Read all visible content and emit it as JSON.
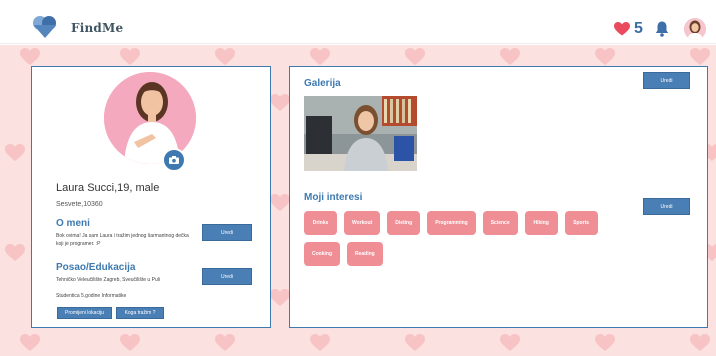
{
  "header": {
    "brand": "FindMe",
    "likes_count": "5",
    "icons": [
      "logo-heart-icon",
      "heart-icon",
      "bell-icon",
      "avatar"
    ]
  },
  "profile": {
    "name_line": "Laura Succi,19, male",
    "location": "Sesvete,10360",
    "about_title": "O meni",
    "about_text": "Bok ovima! Ja sam Laura i tražim jednog šarmantnog dečka koji je programer. :P",
    "about_edit": "Uredi",
    "edu_title": "Posao/Edukacija",
    "edu_line1": "Tehničko Veleučilište Zagreb, Sveučilište u Puli",
    "edu_line2": "Studentica 5.godine Informatike",
    "edu_edit": "Uredi",
    "change_city": "Promijeni lokaciju",
    "who_seek": "Koga tražim ?"
  },
  "gallery": {
    "title": "Galerija",
    "edit": "Uredi"
  },
  "interests": {
    "title": "Moji interesi",
    "edit": "Uredi",
    "items": [
      "Drinks",
      "Workout",
      "Dieting",
      "Programming",
      "Science",
      "Hiking",
      "Sports",
      "Cooking",
      "Reading"
    ]
  },
  "colors": {
    "accent": "#3e7ab0",
    "button": "#4a7fb5",
    "tag": "#f08e96",
    "background": "#fbe1df",
    "heart": "#e94b5c"
  }
}
